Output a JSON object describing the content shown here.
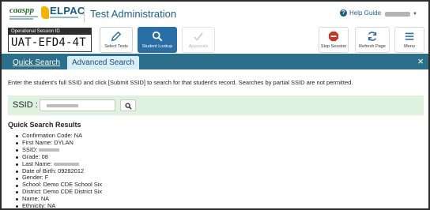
{
  "header": {
    "caaspp_logo": "caaspp",
    "elpac_logo": "ELPAC",
    "title": "Test Administration",
    "help_label": "Help Guide"
  },
  "toolbar": {
    "session_label": "Operational Session ID",
    "session_id": "UAT-EFD4-4T",
    "select_tests": "Select Tests",
    "student_lookup": "Student Lookup",
    "approvals": "Approvals",
    "stop_session": "Stop Session",
    "refresh_page": "Refresh Page",
    "menu": "Menu"
  },
  "tabs": {
    "quick": "Quick Search",
    "advanced": "Advanced Search",
    "close": "×"
  },
  "instructions": "Enter the student's full SSID and click [Submit SSID] to search for that student's record. Searches by partial SSID are not permitted.",
  "search": {
    "label": "SSID :"
  },
  "results": {
    "title": "Quick Search Results",
    "items": [
      "Confirmation Code: NA",
      "First Name: DYLAN",
      "SSID:",
      "Grade: 08",
      "Last Name:",
      "Date of Birth: 09282012",
      "Gender: F",
      "School: Demo CDE School Six",
      "District: Demo CDE District Six",
      "Name: NA",
      "Ethnicity: NA"
    ]
  },
  "colors": {
    "brand_blue": "#1d5e8c",
    "tab_bar": "#2c6f8a",
    "active_tool": "#2a6ea6",
    "search_panel": "#dff1df",
    "stop_red": "#c0392b"
  }
}
